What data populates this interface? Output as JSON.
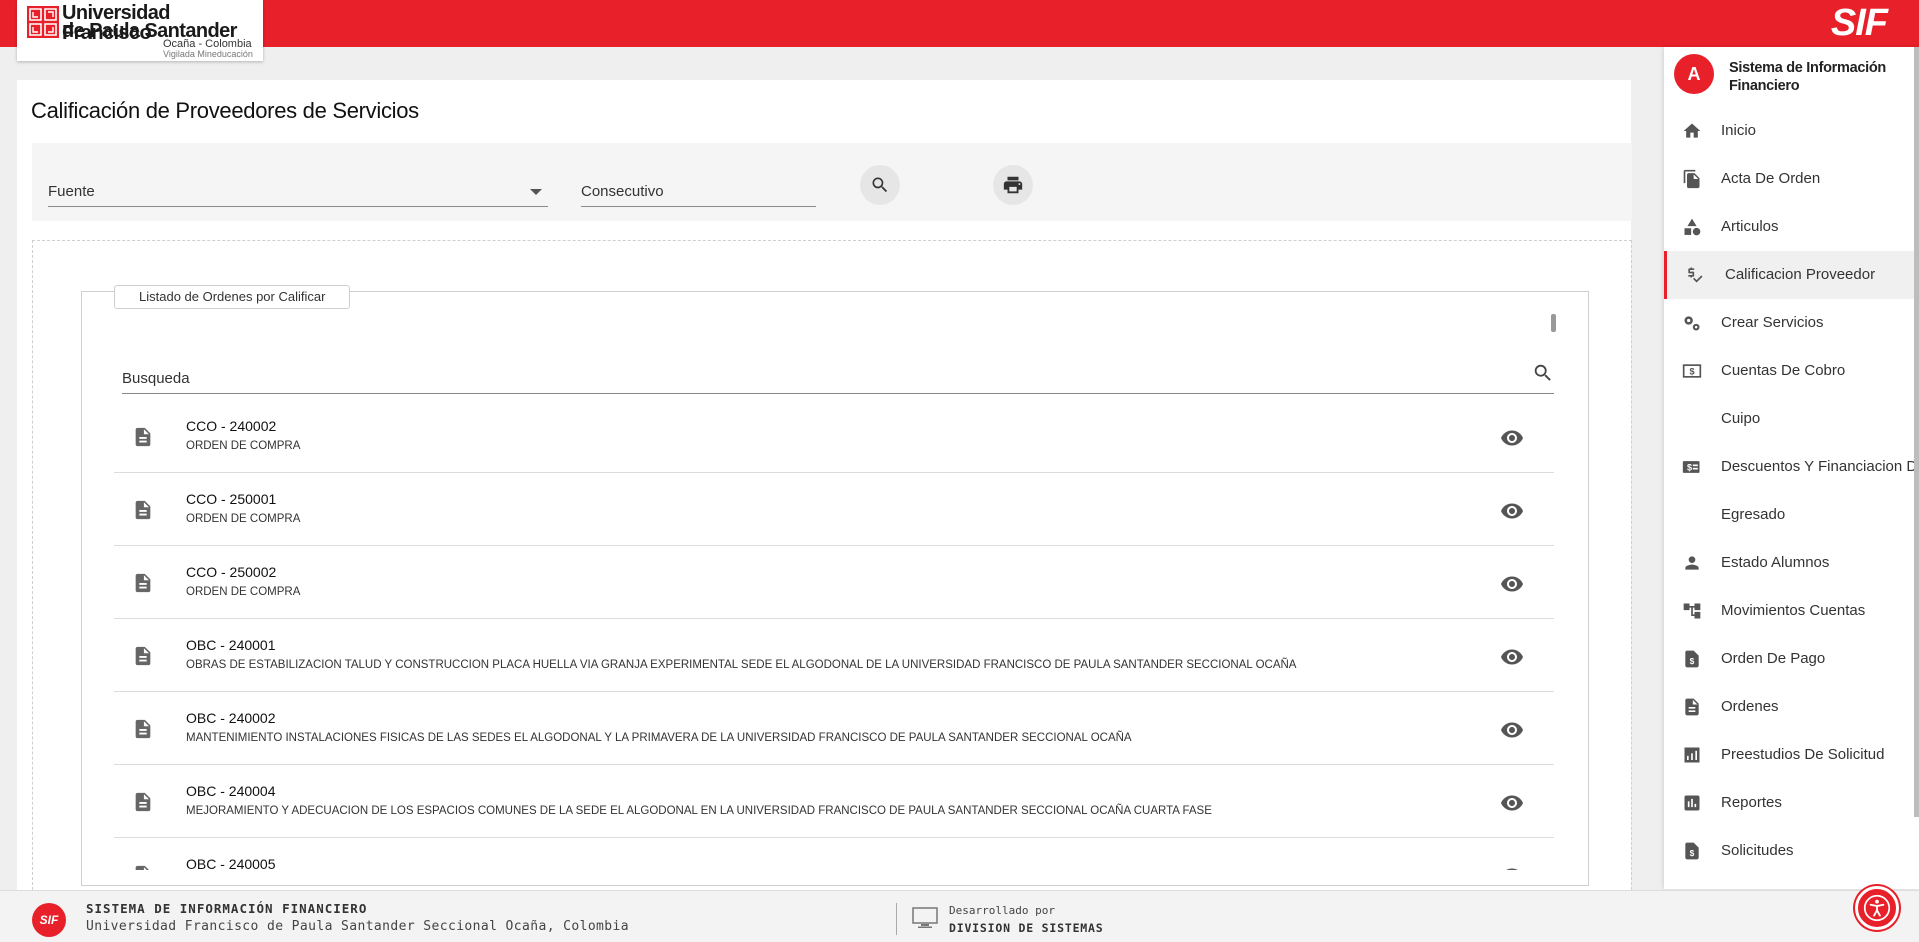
{
  "header": {
    "university_line1": "Universidad Francisco",
    "university_line2": "de Paula Santander",
    "university_sub": "Ocaña - Colombia",
    "university_tagline": "Vigilada Mineducación",
    "brand": "SIF",
    "brand_color": "#e8202a"
  },
  "page": {
    "title": "Calificación de Proveedores de Servicios"
  },
  "filters": {
    "fuente_label": "Fuente",
    "consecutivo_label": "Consecutivo",
    "search_icon": "search-icon",
    "print_icon": "print-icon"
  },
  "list": {
    "legend": "Listado de Ordenes por Calificar",
    "search_label": "Busqueda",
    "rows": [
      {
        "code": "CCO - 240002",
        "desc": "ORDEN DE COMPRA"
      },
      {
        "code": "CCO - 250001",
        "desc": "ORDEN DE COMPRA"
      },
      {
        "code": "CCO - 250002",
        "desc": "ORDEN DE COMPRA"
      },
      {
        "code": "OBC - 240001",
        "desc": "OBRAS DE ESTABILIZACION TALUD Y CONSTRUCCION PLACA HUELLA VIA GRANJA EXPERIMENTAL SEDE EL ALGODONAL DE LA UNIVERSIDAD FRANCISCO DE PAULA SANTANDER SECCIONAL OCAÑA"
      },
      {
        "code": "OBC - 240002",
        "desc": "MANTENIMIENTO INSTALACIONES FISICAS DE LAS SEDES EL ALGODONAL Y LA PRIMAVERA DE LA UNIVERSIDAD FRANCISCO DE PAULA SANTANDER SECCIONAL OCAÑA"
      },
      {
        "code": "OBC - 240004",
        "desc": "MEJORAMIENTO Y ADECUACION DE LOS ESPACIOS COMUNES DE LA SEDE EL ALGODONAL EN LA UNIVERSIDAD FRANCISCO DE PAULA SANTANDER SECCIONAL OCAÑA CUARTA FASE"
      },
      {
        "code": "OBC - 240005",
        "desc": ""
      }
    ]
  },
  "sidebar": {
    "avatar_letter": "A",
    "system_name": "Sistema de Información Financiero",
    "items": [
      {
        "label": "Inicio",
        "icon": "home-icon"
      },
      {
        "label": "Acta De Orden",
        "icon": "file-copy-icon"
      },
      {
        "label": "Articulos",
        "icon": "category-icon"
      },
      {
        "label": "Calificacion Proveedor",
        "icon": "price-check-icon",
        "active": true
      },
      {
        "label": "Crear Servicios",
        "icon": "settings-gears-icon"
      },
      {
        "label": "Cuentas De Cobro",
        "icon": "money-icon"
      },
      {
        "label": "Cuipo",
        "icon": ""
      },
      {
        "label": "Descuentos Y Financiacion D",
        "icon": "money-card-icon"
      },
      {
        "label": "Egresado",
        "icon": ""
      },
      {
        "label": "Estado Alumnos",
        "icon": "person-icon"
      },
      {
        "label": "Movimientos Cuentas",
        "icon": "account-tree-icon"
      },
      {
        "label": "Orden De Pago",
        "icon": "request-quote-icon"
      },
      {
        "label": "Ordenes",
        "icon": "description-icon"
      },
      {
        "label": "Preestudios De Solicitud",
        "icon": "analytics-icon"
      },
      {
        "label": "Reportes",
        "icon": "bar-chart-icon"
      },
      {
        "label": "Solicitudes",
        "icon": "request-quote-icon"
      }
    ]
  },
  "footer": {
    "logo_text": "SIF",
    "title": "SISTEMA DE INFORMACIÓN FINANCIERO",
    "subtitle": "Universidad Francisco de Paula Santander Seccional Ocaña, Colombia",
    "developed_by": "Desarrollado por",
    "division": "DIVISION DE SISTEMAS"
  }
}
